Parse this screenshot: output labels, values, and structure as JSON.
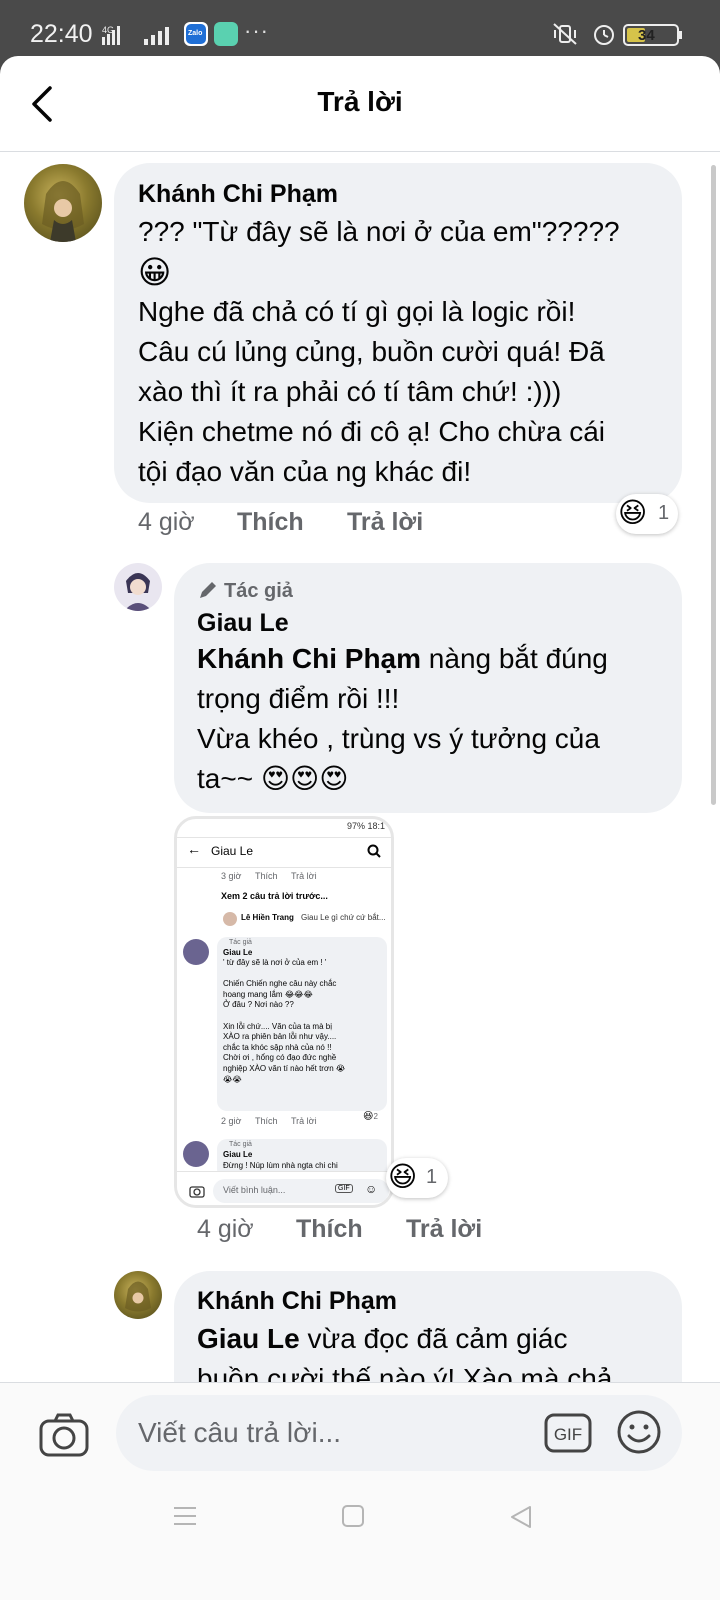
{
  "status_bar": {
    "time": "22:40",
    "network": "4G",
    "apps": [
      "Zalo",
      "app-icon"
    ],
    "more": "···",
    "battery": "34"
  },
  "header": {
    "title": "Trả lời",
    "back_icon": "chevron-left-icon"
  },
  "comments": [
    {
      "author": "Khánh Chi Phạm",
      "lines": [
        "??? \"Từ đây sẽ là nơi ở của em\"?????",
        "😀",
        "Nghe đã chả có tí gì gọi là logic rồi!",
        "Câu cú lủng củng, buồn cười quá! Đã",
        "xào thì ít ra phải có tí tâm chứ!     :)))",
        "Kiện chetme nó đi cô ạ! Cho chừa cái",
        "tội đạo văn của ng khác đi!"
      ],
      "time": "4 giờ",
      "like": "Thích",
      "reply": "Trả lời",
      "reaction": "😆",
      "reaction_count": "1"
    },
    {
      "badge": "Tác giả",
      "author": "Giau Le",
      "mention": "Khánh Chi Phạm",
      "line1_rest": " nàng bắt đúng",
      "lines": [
        "trọng điểm rồi  !!!",
        "Vừa khéo ,  trùng vs ý tưởng của",
        "ta~~ 😍😍😍"
      ],
      "time": "4 giờ",
      "like": "Thích",
      "reply": "Trả lời",
      "reaction": "😆",
      "reaction_count": "1"
    },
    {
      "author": "Khánh Chi Phạm",
      "mention": "Giau Le",
      "line1_rest": " vừa đọc đã cảm giác",
      "line2": "buồn cười thế nào ý! Xào mà chả"
    }
  ],
  "attached_screenshot": {
    "status": "97% 18:1",
    "title": "Giau Le",
    "meta": [
      "3 giờ",
      "Thích",
      "Trả lời"
    ],
    "view_prev": "Xem 2 câu trả lời trước...",
    "preview_name": "Lê Hiền Trang",
    "preview_text": "Giau Le gì chứ cứ bắt...",
    "badge": "Tác giả",
    "author": "Giau Le",
    "lines": [
      "' từ đây sẽ là nơi ở của em ! '",
      "",
      "Chiến Chiến nghe câu này chắc",
      "hoang mang lắm 😂😂😂",
      "Ở đâu  ?  Nơi nào ??",
      "",
      "Xin lỗi chứ.... Văn của ta mà bị",
      "XÀO ra phiên bản lỗi như  vậy....",
      "chắc ta khóc sập nhà của nó !!",
      "Chời ơi  , hổng có đạo đức nghề",
      "nghiệp XÀO văn tí nào hết trơn 😭",
      "😭😭"
    ],
    "meta2": [
      "2 giờ",
      "Thích",
      "Trả lời"
    ],
    "react_count": "2",
    "badge2": "Tác giả",
    "author2": "Giau Le",
    "line_cut": "Đừng ! Núp lùm nhà ngta chi chi",
    "composer_placeholder": "Viết bình luận..."
  },
  "composer": {
    "placeholder": "Viết câu trả lời...",
    "gif_label": "GIF"
  }
}
